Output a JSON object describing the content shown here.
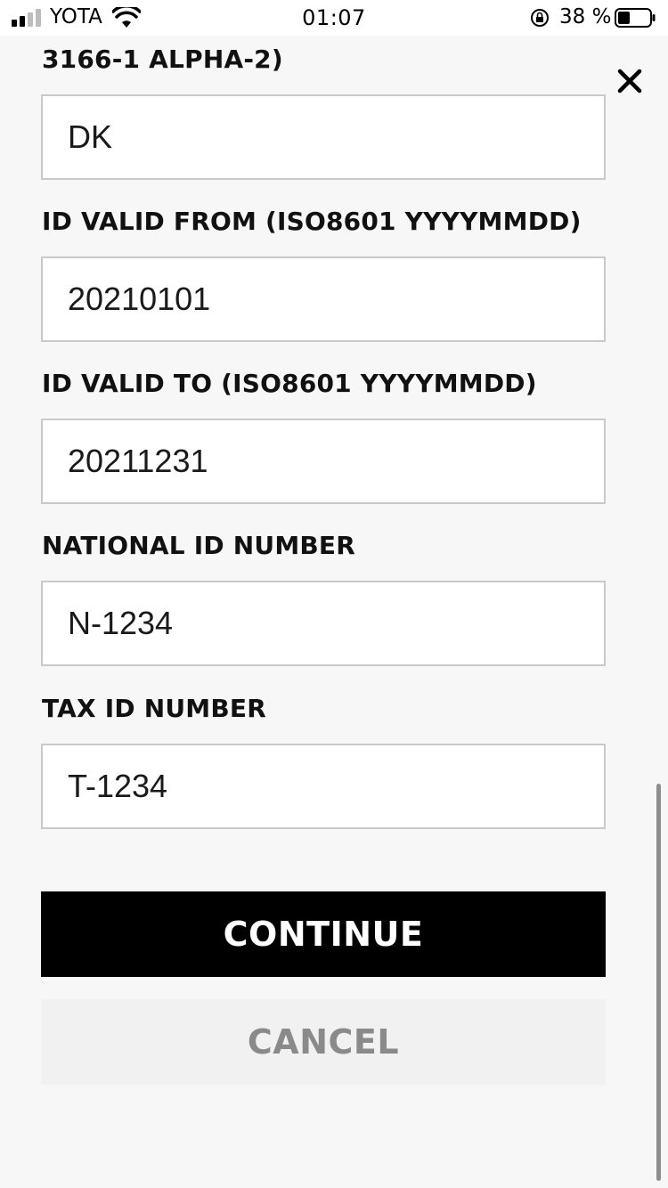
{
  "status_bar": {
    "carrier": "YOTA",
    "time": "01:07",
    "battery_percent": "38 %",
    "icons": [
      "signal-icon",
      "wifi-icon",
      "rotation-lock-icon",
      "battery-icon"
    ]
  },
  "form": {
    "partial_label": "3166-1 ALPHA-2)",
    "country_value": "DK",
    "valid_from_label": "ID VALID FROM (ISO8601 YYYYMMDD)",
    "valid_from_value": "20210101",
    "valid_to_label": "ID VALID TO (ISO8601 YYYYMMDD)",
    "valid_to_value": "20211231",
    "national_id_label": "NATIONAL ID NUMBER",
    "national_id_value": "N-1234",
    "tax_id_label": "TAX ID NUMBER",
    "tax_id_value": "T-1234"
  },
  "actions": {
    "continue_label": "CONTINUE",
    "cancel_label": "CANCEL"
  },
  "colors": {
    "background": "#f7f7f7",
    "primary_button": "#000000",
    "secondary_button": "#f1f1f1",
    "secondary_text": "#8a8a8a",
    "input_border": "#c9c9c9"
  }
}
